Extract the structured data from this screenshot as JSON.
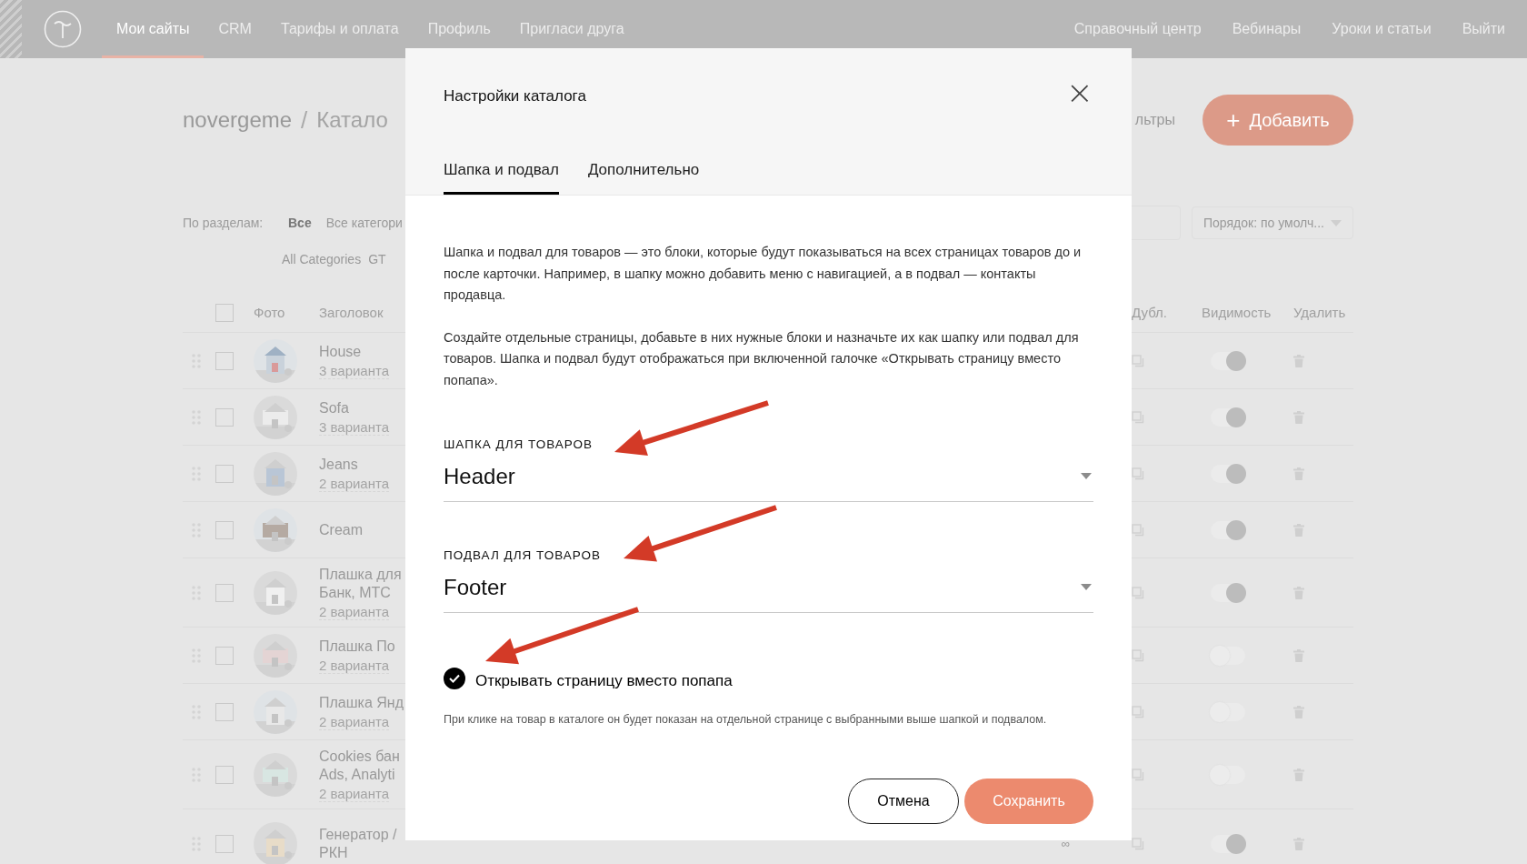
{
  "nav": {
    "left": [
      {
        "label": "Мои сайты",
        "selected": true
      },
      {
        "label": "CRM",
        "selected": false
      },
      {
        "label": "Тарифы и оплата",
        "selected": false
      },
      {
        "label": "Профиль",
        "selected": false
      },
      {
        "label": "Пригласи друга",
        "selected": false
      }
    ],
    "right": [
      "Справочный центр",
      "Вебинары",
      "Уроки и статьи",
      "Выйти"
    ]
  },
  "page": {
    "breadcrumb": [
      "novergeme",
      "/",
      "Катало"
    ],
    "filters_link": "льтры",
    "add_button": {
      "icon": "+",
      "label": "Добавить"
    },
    "filters": {
      "label": "По разделам:",
      "chips": [
        {
          "label": "Все",
          "selected": true
        },
        {
          "label": "Все категори",
          "selected": false
        }
      ],
      "chips_row2": [
        {
          "label": "All Categories",
          "selected": false
        },
        {
          "label": "GT",
          "selected": false
        }
      ]
    },
    "sort": {
      "value": "Порядок: по умолч..."
    }
  },
  "table": {
    "select_all_checked": false,
    "columns": [
      "Фото",
      "Заголовок",
      "Дубл.",
      "Видимость",
      "Удалить"
    ],
    "rows": [
      {
        "title": [
          "House"
        ],
        "variants": "3 варианта",
        "checked": false,
        "visible": true,
        "photo": {
          "kind": "picture"
        }
      },
      {
        "title": [
          "Sofa"
        ],
        "variants": "3 варианта",
        "checked": false,
        "visible": true,
        "photo": {
          "kind": "picture"
        }
      },
      {
        "title": [
          "Jeans"
        ],
        "variants": "2 варианта",
        "checked": false,
        "visible": true,
        "photo": {
          "kind": "picture"
        }
      },
      {
        "title": [
          "Cream"
        ],
        "checked": false,
        "visible": true,
        "photo": {
          "kind": "picture"
        }
      },
      {
        "title": [
          "Плашка для",
          "Банк, МТС"
        ],
        "variants": "2 варианта",
        "checked": false,
        "visible": true,
        "photo": {
          "kind": "picture"
        }
      },
      {
        "title": [
          "Плашка По"
        ],
        "variants": "2 варианта",
        "checked": false,
        "visible": false,
        "photo": {
          "kind": "picture"
        }
      },
      {
        "title": [
          "Плашка Янд"
        ],
        "variants": "2 варианта",
        "checked": false,
        "visible": false,
        "photo": {
          "kind": "picture"
        }
      },
      {
        "title": [
          "Cookies бан",
          "Ads, Analyti"
        ],
        "variants": "2 варианта",
        "checked": false,
        "visible": false,
        "photo": {
          "kind": "picture"
        }
      },
      {
        "title": [
          "Генератор /",
          "РКН"
        ],
        "extra": "∞",
        "checked": false,
        "visible": true,
        "photo": {
          "kind": "picture"
        }
      }
    ]
  },
  "modal": {
    "title": "Настройки каталога",
    "close": "×",
    "tabs": [
      {
        "label": "Шапка и подвал",
        "selected": true
      },
      {
        "label": "Дополнительно",
        "selected": false
      }
    ],
    "paragraphs": [
      "Шапка и подвал для товаров — это блоки, которые будут показываться на всех страницах товаров до и после карточки. Например, в шапку можно добавить меню с навигацией, а в подвал — контакты продавца.",
      "Создайте отдельные страницы, добавьте в них нужные блоки и назначьте их как шапку или подвал для товаров. Шапка и подвал будут отображаться при включенной галочке «Открывать страницу вместо попапа»."
    ],
    "selects": [
      {
        "label": "ШАПКА ДЛЯ ТОВАРОВ",
        "value": "Header"
      },
      {
        "label": "ПОДВАЛ ДЛЯ ТОВАРОВ",
        "value": "Footer"
      }
    ],
    "checkbox": {
      "label": "Открывать страницу вместо попапа",
      "checked": true
    },
    "hint": "При клике на товар в каталоге он будет показан на отдельной странице с выбранными выше шапкой и подвалом.",
    "buttons": [
      {
        "label": "Отмена",
        "kind": "secondary"
      },
      {
        "label": "Сохранить",
        "kind": "primary"
      }
    ]
  }
}
